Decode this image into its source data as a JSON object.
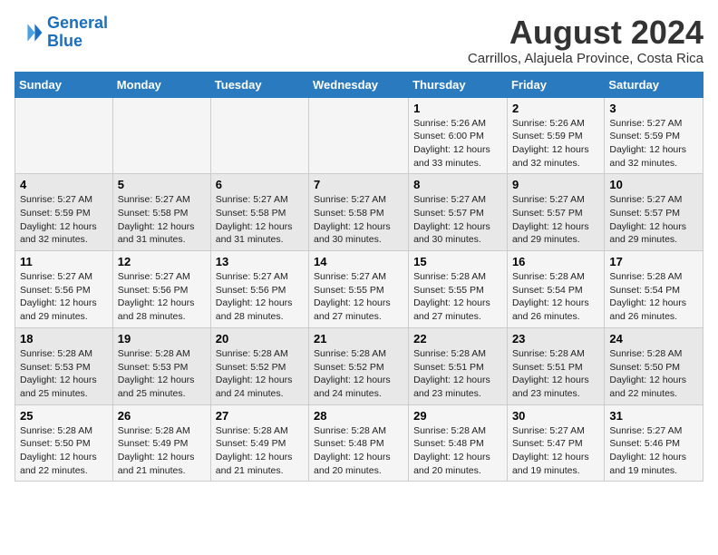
{
  "logo": {
    "line1": "General",
    "line2": "Blue"
  },
  "title": {
    "month_year": "August 2024",
    "location": "Carrillos, Alajuela Province, Costa Rica"
  },
  "weekdays": [
    "Sunday",
    "Monday",
    "Tuesday",
    "Wednesday",
    "Thursday",
    "Friday",
    "Saturday"
  ],
  "weeks": [
    [
      {
        "day": "",
        "info": ""
      },
      {
        "day": "",
        "info": ""
      },
      {
        "day": "",
        "info": ""
      },
      {
        "day": "",
        "info": ""
      },
      {
        "day": "1",
        "info": "Sunrise: 5:26 AM\nSunset: 6:00 PM\nDaylight: 12 hours\nand 33 minutes."
      },
      {
        "day": "2",
        "info": "Sunrise: 5:26 AM\nSunset: 5:59 PM\nDaylight: 12 hours\nand 32 minutes."
      },
      {
        "day": "3",
        "info": "Sunrise: 5:27 AM\nSunset: 5:59 PM\nDaylight: 12 hours\nand 32 minutes."
      }
    ],
    [
      {
        "day": "4",
        "info": "Sunrise: 5:27 AM\nSunset: 5:59 PM\nDaylight: 12 hours\nand 32 minutes."
      },
      {
        "day": "5",
        "info": "Sunrise: 5:27 AM\nSunset: 5:58 PM\nDaylight: 12 hours\nand 31 minutes."
      },
      {
        "day": "6",
        "info": "Sunrise: 5:27 AM\nSunset: 5:58 PM\nDaylight: 12 hours\nand 31 minutes."
      },
      {
        "day": "7",
        "info": "Sunrise: 5:27 AM\nSunset: 5:58 PM\nDaylight: 12 hours\nand 30 minutes."
      },
      {
        "day": "8",
        "info": "Sunrise: 5:27 AM\nSunset: 5:57 PM\nDaylight: 12 hours\nand 30 minutes."
      },
      {
        "day": "9",
        "info": "Sunrise: 5:27 AM\nSunset: 5:57 PM\nDaylight: 12 hours\nand 29 minutes."
      },
      {
        "day": "10",
        "info": "Sunrise: 5:27 AM\nSunset: 5:57 PM\nDaylight: 12 hours\nand 29 minutes."
      }
    ],
    [
      {
        "day": "11",
        "info": "Sunrise: 5:27 AM\nSunset: 5:56 PM\nDaylight: 12 hours\nand 29 minutes."
      },
      {
        "day": "12",
        "info": "Sunrise: 5:27 AM\nSunset: 5:56 PM\nDaylight: 12 hours\nand 28 minutes."
      },
      {
        "day": "13",
        "info": "Sunrise: 5:27 AM\nSunset: 5:56 PM\nDaylight: 12 hours\nand 28 minutes."
      },
      {
        "day": "14",
        "info": "Sunrise: 5:27 AM\nSunset: 5:55 PM\nDaylight: 12 hours\nand 27 minutes."
      },
      {
        "day": "15",
        "info": "Sunrise: 5:28 AM\nSunset: 5:55 PM\nDaylight: 12 hours\nand 27 minutes."
      },
      {
        "day": "16",
        "info": "Sunrise: 5:28 AM\nSunset: 5:54 PM\nDaylight: 12 hours\nand 26 minutes."
      },
      {
        "day": "17",
        "info": "Sunrise: 5:28 AM\nSunset: 5:54 PM\nDaylight: 12 hours\nand 26 minutes."
      }
    ],
    [
      {
        "day": "18",
        "info": "Sunrise: 5:28 AM\nSunset: 5:53 PM\nDaylight: 12 hours\nand 25 minutes."
      },
      {
        "day": "19",
        "info": "Sunrise: 5:28 AM\nSunset: 5:53 PM\nDaylight: 12 hours\nand 25 minutes."
      },
      {
        "day": "20",
        "info": "Sunrise: 5:28 AM\nSunset: 5:52 PM\nDaylight: 12 hours\nand 24 minutes."
      },
      {
        "day": "21",
        "info": "Sunrise: 5:28 AM\nSunset: 5:52 PM\nDaylight: 12 hours\nand 24 minutes."
      },
      {
        "day": "22",
        "info": "Sunrise: 5:28 AM\nSunset: 5:51 PM\nDaylight: 12 hours\nand 23 minutes."
      },
      {
        "day": "23",
        "info": "Sunrise: 5:28 AM\nSunset: 5:51 PM\nDaylight: 12 hours\nand 23 minutes."
      },
      {
        "day": "24",
        "info": "Sunrise: 5:28 AM\nSunset: 5:50 PM\nDaylight: 12 hours\nand 22 minutes."
      }
    ],
    [
      {
        "day": "25",
        "info": "Sunrise: 5:28 AM\nSunset: 5:50 PM\nDaylight: 12 hours\nand 22 minutes."
      },
      {
        "day": "26",
        "info": "Sunrise: 5:28 AM\nSunset: 5:49 PM\nDaylight: 12 hours\nand 21 minutes."
      },
      {
        "day": "27",
        "info": "Sunrise: 5:28 AM\nSunset: 5:49 PM\nDaylight: 12 hours\nand 21 minutes."
      },
      {
        "day": "28",
        "info": "Sunrise: 5:28 AM\nSunset: 5:48 PM\nDaylight: 12 hours\nand 20 minutes."
      },
      {
        "day": "29",
        "info": "Sunrise: 5:28 AM\nSunset: 5:48 PM\nDaylight: 12 hours\nand 20 minutes."
      },
      {
        "day": "30",
        "info": "Sunrise: 5:27 AM\nSunset: 5:47 PM\nDaylight: 12 hours\nand 19 minutes."
      },
      {
        "day": "31",
        "info": "Sunrise: 5:27 AM\nSunset: 5:46 PM\nDaylight: 12 hours\nand 19 minutes."
      }
    ]
  ]
}
